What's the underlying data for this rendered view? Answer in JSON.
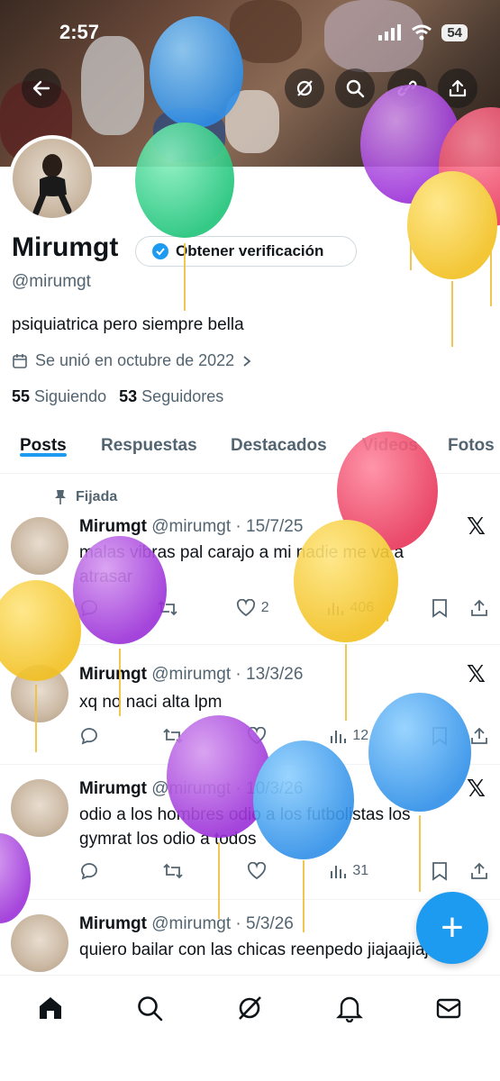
{
  "status": {
    "time": "2:57",
    "battery": "54"
  },
  "profile": {
    "name": "Mirumgt",
    "verify_button": "Obtener verificación",
    "handle": "@mirumgt",
    "bio": "psiquiatrica pero siempre bella",
    "joined": "Se unió en octubre de 2022",
    "following_count": "55",
    "following_label": "Siguiendo",
    "followers_count": "53",
    "followers_label": "Seguidores"
  },
  "tabs": [
    "Posts",
    "Respuestas",
    "Destacados",
    "Videos",
    "Fotos"
  ],
  "pinned_label": "Fijada",
  "posts": [
    {
      "name": "Mirumgt",
      "meta": "@mirumgt · 15/7/25",
      "text": "malas vibras pal carajo a mi nadie me va a atrasar",
      "likes": "2",
      "views": "406"
    },
    {
      "name": "Mirumgt",
      "meta": "@mirumgt · 13/3/26",
      "text": "xq no naci alta lpm",
      "likes": "",
      "views": "12"
    },
    {
      "name": "Mirumgt",
      "meta": "@mirumgt · 10/3/26",
      "text": "odio a los hombres odio a los futbolistas los gymrat los odio a todos",
      "likes": "",
      "views": "31"
    },
    {
      "name": "Mirumgt",
      "meta": "@mirumgt · 5/3/26",
      "text": "quiero bailar con las chicas reenpedo jiajaajiajaja"
    }
  ],
  "colors": {
    "accent": "#1d9bf0",
    "text": "#0f1419",
    "muted": "#536471"
  }
}
